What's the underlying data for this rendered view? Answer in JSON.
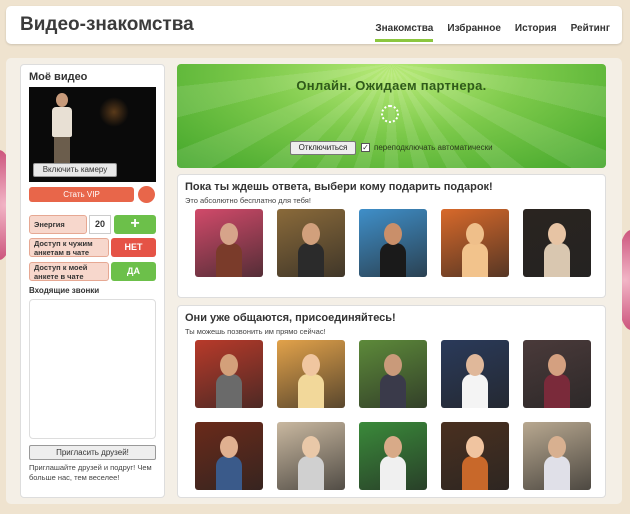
{
  "header": {
    "brand": "Видео-знакомства",
    "nav": [
      {
        "label": "Знакомства",
        "active": true
      },
      {
        "label": "Избранное",
        "active": false
      },
      {
        "label": "История",
        "active": false
      },
      {
        "label": "Рейтинг",
        "active": false
      }
    ]
  },
  "sidebar": {
    "title": "Моё видео",
    "camera_button": "Включить камеру",
    "vip_button": "Стать VIP",
    "energy": {
      "label": "Энергия",
      "value": "20",
      "plus": "+"
    },
    "access_others": {
      "label": "Доступ к чужим анкетам в чате",
      "state": "НЕТ"
    },
    "access_mine": {
      "label": "Доступ к моей анкете в чате",
      "state": "ДА"
    },
    "calls_title": "Входящие звонки",
    "invite_button": "Пригласить друзей!",
    "invite_text": "Приглашайте друзей и подруг! Чем больше нас, тем веселее!"
  },
  "status": {
    "title": "Онлайн. Ожидаем партнера.",
    "disconnect_button": "Отключиться",
    "auto_reconnect_checked": true,
    "auto_reconnect_label": "переподключать автоматически"
  },
  "gift_panel": {
    "title": "Пока ты ждешь ответа, выбери кому подарить подарок!",
    "subtitle": "Это абсолютно бесплатно для тебя!",
    "photos": [
      {
        "icon": "user-photo",
        "bg": "#d14a6a",
        "skin": "#d6a48a",
        "cloth": "#7a3b2a"
      },
      {
        "icon": "user-photo",
        "bg": "#8a6a3a",
        "skin": "#d1a07c",
        "cloth": "#2b2b2b"
      },
      {
        "icon": "user-photo",
        "bg": "#3f8fc9",
        "skin": "#c98f6a",
        "cloth": "#1a1a1a"
      },
      {
        "icon": "user-photo",
        "bg": "#d8692a",
        "skin": "#efbf8a",
        "cloth": "#f2c38c"
      },
      {
        "icon": "user-photo",
        "bg": "#2a2420",
        "skin": "#e7c4a4",
        "cloth": "#d9c7b0"
      }
    ]
  },
  "join_panel": {
    "title": "Они уже общаются, присоединяйтесь!",
    "subtitle": "Ты можешь позвонить им прямо сейчас!",
    "photos": [
      {
        "icon": "user-photo",
        "bg": "#b83a2a",
        "skin": "#d3a07a",
        "cloth": "#6a6a6a"
      },
      {
        "icon": "user-photo",
        "bg": "#e2a24a",
        "skin": "#f0c6a0",
        "cloth": "#f2d89a"
      },
      {
        "icon": "user-photo",
        "bg": "#5d8a3a",
        "skin": "#c99a7a",
        "cloth": "#3a3a4a"
      },
      {
        "icon": "user-photo",
        "bg": "#2a3a5a",
        "skin": "#e0b89a",
        "cloth": "#f4f4f4"
      },
      {
        "icon": "user-photo",
        "bg": "#4a3a3a",
        "skin": "#d4a080",
        "cloth": "#7a2a3a"
      },
      {
        "icon": "user-photo",
        "bg": "#6a2a1a",
        "skin": "#e0b090",
        "cloth": "#3a5a8a"
      },
      {
        "icon": "user-photo",
        "bg": "#c9b8a0",
        "skin": "#e9c8a8",
        "cloth": "#d0d0d0"
      },
      {
        "icon": "user-photo",
        "bg": "#3a8a3a",
        "skin": "#d8aa88",
        "cloth": "#f0f0f0"
      },
      {
        "icon": "user-photo",
        "bg": "#4a3020",
        "skin": "#f0c4a0",
        "cloth": "#c8682a"
      },
      {
        "icon": "user-photo",
        "bg": "#b8a890",
        "skin": "#d8b090",
        "cloth": "#e0e0e8"
      }
    ]
  }
}
